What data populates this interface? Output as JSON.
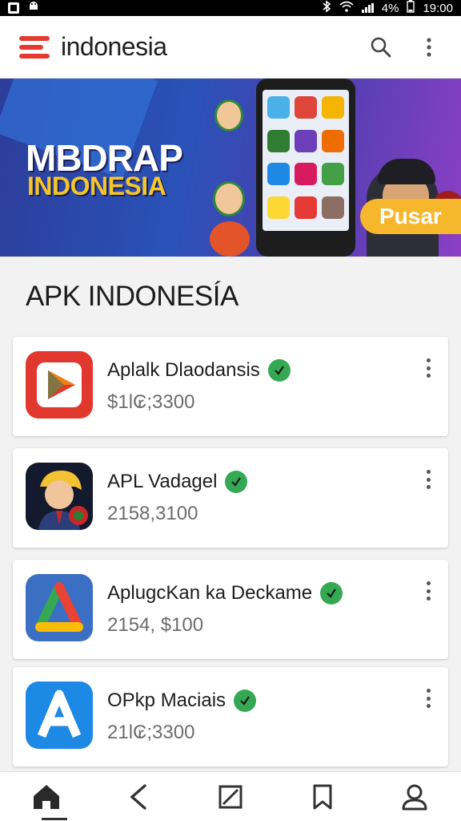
{
  "status_bar": {
    "battery": "4%",
    "time": "19:00"
  },
  "app_bar": {
    "title": "indonesia",
    "brand_color": "#e53a2f"
  },
  "banner": {
    "title": "MBDRAP",
    "subtitle": "INDONESIA",
    "button_label": "Pusar"
  },
  "section": {
    "title": "APK INDONESÍA"
  },
  "apps": [
    {
      "name": "Aplalk Dlaodansis",
      "meta": "$1l₢;3300",
      "icon": "play-store-icon"
    },
    {
      "name": "APL Vadagel",
      "meta": "2158,3100",
      "icon": "cartoon-man-icon"
    },
    {
      "name": "AplugcKan ka Deckame",
      "meta": "2154, $100",
      "icon": "triangle-logo-icon"
    },
    {
      "name": "OPkp Maciais",
      "meta": "21l₢;3300",
      "icon": "letter-a-icon"
    }
  ],
  "bottom_nav": [
    "home",
    "back",
    "edit",
    "bookmark",
    "profile"
  ]
}
